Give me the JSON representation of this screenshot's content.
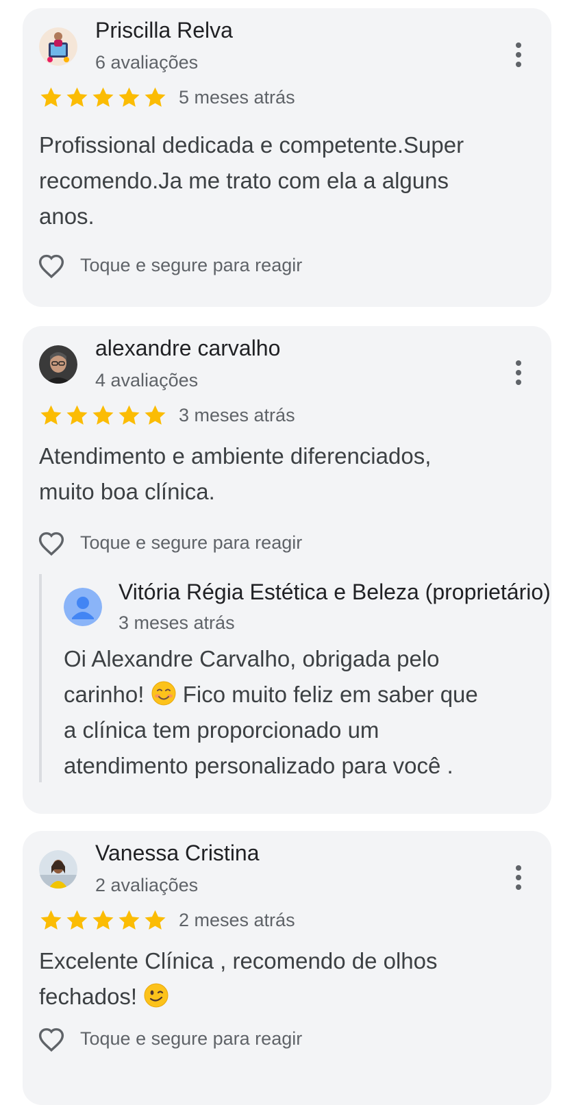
{
  "colors": {
    "card_background": "#f3f4f6",
    "star": "#fbbc04",
    "primary_text": "#202124",
    "secondary_text": "#5f6368",
    "body_text": "#3c4043",
    "reply_border": "#dadce0",
    "default_avatar": "#8ab4f8"
  },
  "icons": {
    "more": "more-vert-icon",
    "react": "heart-outline-icon",
    "star": "star-icon"
  },
  "reviews": [
    {
      "author": "Priscilla Relva",
      "review_count": "6 avaliações",
      "rating": 5,
      "time": "5 meses atrás",
      "text_lines": [
        "Profissional dedicada e competente.Super",
        "recomendo.Ja me trato com ela a alguns",
        "anos."
      ],
      "react_label": "Toque e segure para reagir"
    },
    {
      "author": "alexandre carvalho",
      "review_count": "4 avaliações",
      "rating": 5,
      "time": "3 meses atrás",
      "text_lines": [
        "Atendimento e ambiente diferenciados,",
        "muito boa clínica."
      ],
      "react_label": "Toque e segure para reagir",
      "owner_reply": {
        "name": "Vitória Régia Estética e Beleza (proprietário)",
        "time": "3 meses atrás",
        "line_1": "Oi Alexandre Carvalho, obrigada pelo",
        "line_2_before_emoji": "carinho! ",
        "line_2_after_emoji": " Fico muito feliz em saber que",
        "line_3": "a clínica tem proporcionado um",
        "line_4": "atendimento personalizado para você ."
      }
    },
    {
      "author": "Vanessa Cristina",
      "review_count": "2 avaliações",
      "rating": 5,
      "time": "2 meses atrás",
      "text_line_1": "Excelente Clínica , recomendo de olhos",
      "text_line_2": "fechados! ",
      "react_label": "Toque e segure para reagir"
    }
  ]
}
